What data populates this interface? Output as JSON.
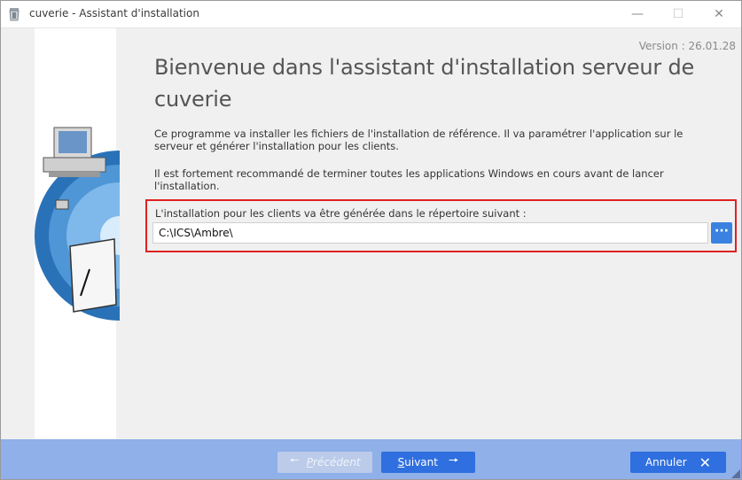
{
  "window": {
    "title": "cuverie - Assistant d'installation",
    "controls": {
      "minimize": "—",
      "maximize": "☐",
      "close": "✕"
    }
  },
  "content": {
    "version": "Version : 26.01.28",
    "heading": "Bienvenue dans l'assistant d'installation serveur de cuverie",
    "paragraph1": "Ce programme va installer les fichiers de l'installation de référence. Il va paramétrer l'application sur le serveur et générer l'installation pour les clients.",
    "paragraph2": "Il est fortement recommandé de terminer toutes les applications Windows en cours avant de lancer l'installation.",
    "directory": {
      "label": "L'installation pour les clients va être générée dans le répertoire suivant :",
      "value": "C:\\ICS\\Ambre\\",
      "browse_label": "···"
    }
  },
  "footer": {
    "previous": {
      "prefix": "",
      "underlined": "P",
      "rest": "récédent",
      "icon": "arrow-left-icon",
      "enabled": false
    },
    "next": {
      "underlined": "S",
      "rest": "uivant",
      "icon": "arrow-right-icon",
      "enabled": true
    },
    "cancel": {
      "label": "Annuler",
      "icon": "close-icon",
      "enabled": true
    }
  },
  "colors": {
    "accent": "#2f6fdf",
    "footer_bg": "#8fb0e8",
    "highlight_border": "#e02020",
    "browse_button": "#3b82e0"
  }
}
